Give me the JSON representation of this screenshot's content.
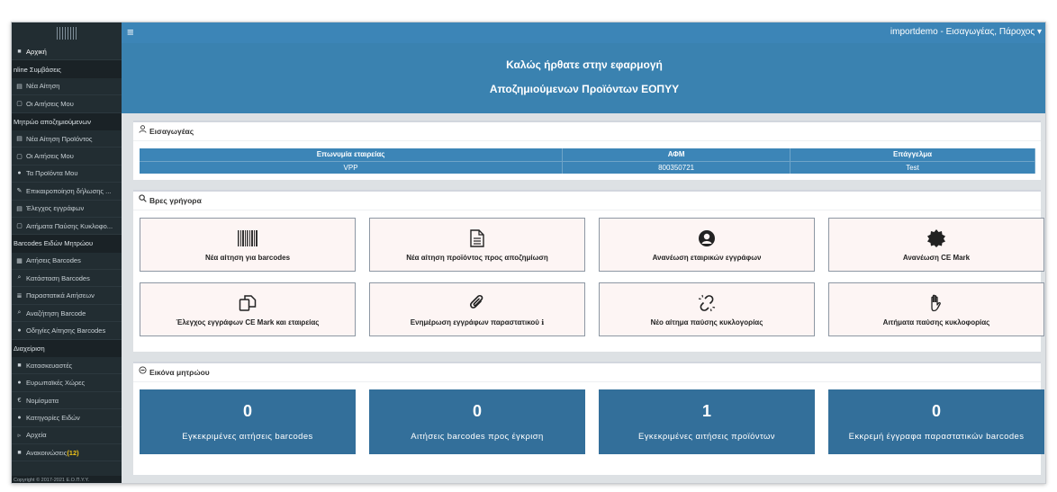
{
  "topbar": {
    "menu_toggle": "≡",
    "user_label": "importdemo - Εισαγωγέας, Πάροχος ▾"
  },
  "sidebar": {
    "items": [
      {
        "type": "item",
        "icon": "home-icon",
        "glyph": "■",
        "label": "Αρχική",
        "top": true
      },
      {
        "type": "header",
        "label": "nline Συμβάσεις"
      },
      {
        "type": "item",
        "icon": "file-add-icon",
        "glyph": "▤",
        "label": "Νέα Αίτηση"
      },
      {
        "type": "item",
        "icon": "folder-icon",
        "glyph": "▢",
        "label": "Οι Αιτήσεις Μου"
      },
      {
        "type": "header",
        "label": "Μητρώο αποζημιούμενων"
      },
      {
        "type": "item",
        "icon": "file-add-icon",
        "glyph": "▤",
        "label": "Νέα Αίτηση Προϊόντος"
      },
      {
        "type": "item",
        "icon": "folder-icon",
        "glyph": "▢",
        "label": "Οι Αιτήσεις Μου"
      },
      {
        "type": "item",
        "icon": "box-icon",
        "glyph": "●",
        "label": "Τα Προϊόντα Μου"
      },
      {
        "type": "item",
        "icon": "edit-icon",
        "glyph": "✎",
        "label": "Επικαιροποίηση δήλωσης ..."
      },
      {
        "type": "item",
        "icon": "document-check-icon",
        "glyph": "▤",
        "label": "Έλεγχος εγγράφων"
      },
      {
        "type": "item",
        "icon": "stop-icon",
        "glyph": "▢",
        "label": "Αιτήματα Παύσης Κυκλοφο..."
      },
      {
        "type": "header",
        "label": "Barcodes Ειδών Μητρώου"
      },
      {
        "type": "item",
        "icon": "barcode-icon",
        "glyph": "▦",
        "label": "Αιτήσεις Barcodes"
      },
      {
        "type": "item",
        "icon": "search-icon",
        "glyph": "⌕",
        "label": "Κατάσταση Barcodes"
      },
      {
        "type": "item",
        "icon": "list-icon",
        "glyph": "≣",
        "label": "Παραστατικά Αιτήσεων"
      },
      {
        "type": "item",
        "icon": "search-icon",
        "glyph": "⌕",
        "label": "Αναζήτηση Barcode"
      },
      {
        "type": "item",
        "icon": "info-icon",
        "glyph": "●",
        "label": "Οδηγίες Αίτησης Barcodes"
      },
      {
        "type": "header",
        "label": "Διαχείριση"
      },
      {
        "type": "item",
        "icon": "factory-icon",
        "glyph": "■",
        "label": "Κατασκευαστές"
      },
      {
        "type": "item",
        "icon": "globe-icon",
        "glyph": "●",
        "label": "Ευρωπαϊκές Χώρες"
      },
      {
        "type": "item",
        "icon": "currency-icon",
        "glyph": "€",
        "label": "Νομίσματα"
      },
      {
        "type": "item",
        "icon": "category-icon",
        "glyph": "●",
        "label": "Κατηγορίες Ειδών"
      },
      {
        "type": "item",
        "icon": "files-icon",
        "glyph": "▹",
        "label": "Αρχεία"
      },
      {
        "type": "item",
        "icon": "announcement-icon",
        "glyph": "■",
        "label": "Ανακοινώσεις",
        "badge": "(12)"
      }
    ],
    "footer": "Copyright © 2017-2021 Ε.Ο.Π.Υ.Υ."
  },
  "banner": {
    "line1": "Καλώς ήρθατε στην εφαρμογή",
    "line2": "Αποζημιούμενων Προϊόντων ΕΟΠΥΥ"
  },
  "importer": {
    "title": "Εισαγωγέας",
    "columns": [
      "Επωνυμία εταιρείας",
      "ΑΦΜ",
      "Επάγγελμα"
    ],
    "row": [
      "VPP",
      "800350721",
      "Test"
    ]
  },
  "quick": {
    "title": "Βρες γρήγορα",
    "tiles": [
      {
        "icon": "barcode-icon",
        "label": "Νέα αίτηση για barcodes"
      },
      {
        "icon": "file-icon",
        "label": "Νέα αίτηση προϊόντος προς αποζημίωση"
      },
      {
        "icon": "user-circle-icon",
        "label": "Ανανέωση εταιρικών εγγράφων"
      },
      {
        "icon": "certificate-icon",
        "label": "Ανανέωση CE Mark"
      },
      {
        "icon": "copy-documents-icon",
        "label": "Έλεγχος εγγράφων CE Mark και εταιρείας"
      },
      {
        "icon": "paperclip-icon",
        "label": "Ενημέρωση εγγράφων παραστατικού ℹ"
      },
      {
        "icon": "unlink-icon",
        "label": "Νέο αίτημα παύσης κυκλογορίας"
      },
      {
        "icon": "hand-stop-icon",
        "label": "Αιτήματα παύσης κυκλοφορίας"
      }
    ]
  },
  "registry": {
    "title": "Εικόνα μητρώου",
    "stats": [
      {
        "value": "0",
        "label": "Εγκεκριμένες αιτήσεις barcodes"
      },
      {
        "value": "0",
        "label": "Αιτήσεις barcodes προς έγκριση"
      },
      {
        "value": "1",
        "label": "Εγκεκριμένες αιτήσεις προϊόντων"
      },
      {
        "value": "0",
        "label": "Εκκρεμή έγγραφα παραστατικών barcodes"
      }
    ]
  }
}
